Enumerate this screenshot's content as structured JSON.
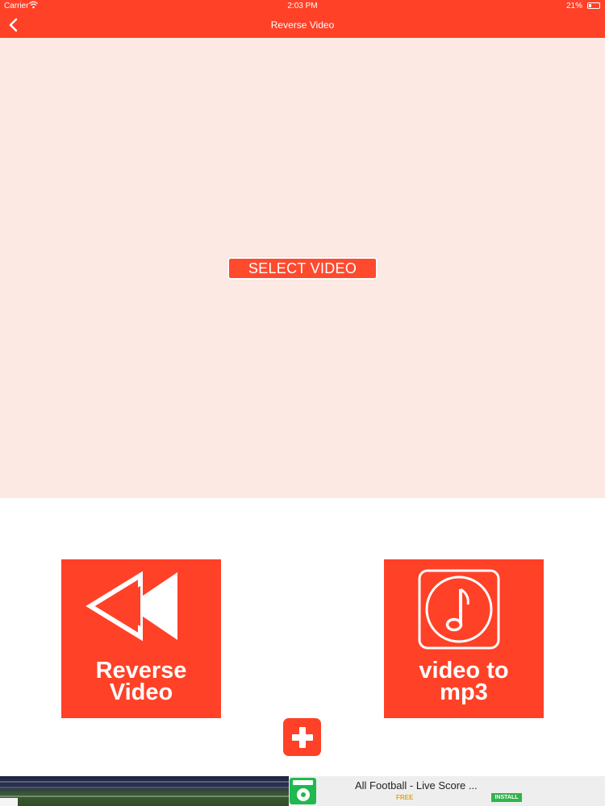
{
  "status_bar": {
    "carrier": "Carrier",
    "time": "2:03 PM",
    "battery": "21%"
  },
  "nav": {
    "title": "Reverse Video",
    "back_icon": "chevron-left-icon"
  },
  "preview": {
    "select_label": "SELECT VIDEO"
  },
  "tiles": [
    {
      "label": "Reverse Video",
      "icon": "rewind-icon"
    },
    {
      "label": "video to mp3",
      "icon": "music-note-icon"
    }
  ],
  "add_button": {
    "icon": "plus-icon"
  },
  "ad": {
    "title": "All Football - Live Score ...",
    "price": "FREE",
    "install_label": "INSTALL"
  },
  "colors": {
    "accent": "#ff4127",
    "preview_bg": "#fde9e4"
  }
}
